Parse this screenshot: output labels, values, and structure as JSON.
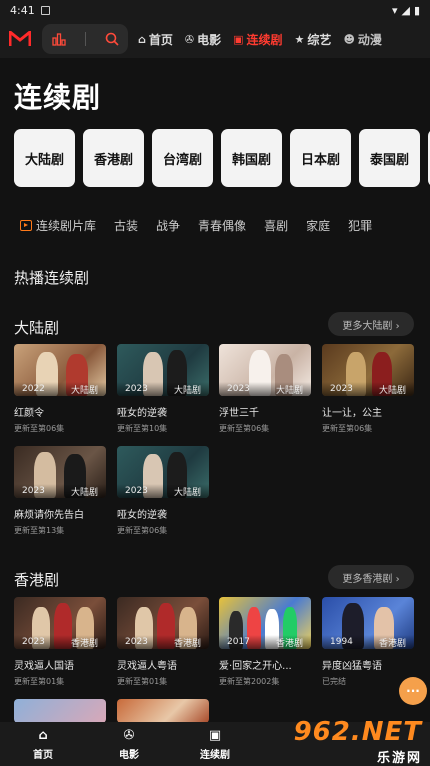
{
  "status": {
    "time": "4:41"
  },
  "topnav": {
    "tabs": [
      {
        "label": "首页",
        "icon": "home-icon"
      },
      {
        "label": "电影",
        "icon": "film-reel-icon"
      },
      {
        "label": "连续剧",
        "icon": "tv-icon"
      },
      {
        "label": "综艺",
        "icon": "star-icon"
      },
      {
        "label": "动漫",
        "icon": "mask-icon"
      }
    ]
  },
  "headline": "连续剧",
  "regions": [
    "大陆剧",
    "香港剧",
    "台湾剧",
    "韩国剧",
    "日本剧",
    "泰国剧"
  ],
  "filters": [
    "连续剧片库",
    "古装",
    "战争",
    "青春偶像",
    "喜剧",
    "家庭",
    "犯罪"
  ],
  "hot_title": "热播连续剧",
  "sections": [
    {
      "title": "大陆剧",
      "more": "更多大陆剧 ›",
      "cards": [
        {
          "year": "2022",
          "region": "大陆剧",
          "title": "红颜令",
          "sub": "更新至第06集"
        },
        {
          "year": "2023",
          "region": "大陆剧",
          "title": "哑女的逆袭",
          "sub": "更新至第10集"
        },
        {
          "year": "2023",
          "region": "大陆剧",
          "title": "浮世三千",
          "sub": "更新至第06集"
        },
        {
          "year": "2023",
          "region": "大陆剧",
          "title": "让一让，公主",
          "sub": "更新至第06集"
        },
        {
          "year": "2023",
          "region": "大陆剧",
          "title": "麻烦请你先告白",
          "sub": "更新至第13集"
        },
        {
          "year": "2023",
          "region": "大陆剧",
          "title": "哑女的逆袭",
          "sub": "更新至第06集"
        }
      ]
    },
    {
      "title": "香港剧",
      "more": "更多香港剧 ›",
      "cards": [
        {
          "year": "2023",
          "region": "香港剧",
          "title": "灵戏逼人国语",
          "sub": "更新至第01集"
        },
        {
          "year": "2023",
          "region": "香港剧",
          "title": "灵戏逼人粤语",
          "sub": "更新至第01集"
        },
        {
          "year": "2017",
          "region": "香港剧",
          "title": "爱·回家之开心...",
          "sub": "更新至第2002集"
        },
        {
          "year": "1994",
          "region": "香港剧",
          "title": "异度凶猛粤语",
          "sub": "已完结"
        }
      ]
    }
  ],
  "bottombar": [
    {
      "label": "首页",
      "icon": "home-icon"
    },
    {
      "label": "电影",
      "icon": "film-reel-icon"
    },
    {
      "label": "连续剧",
      "icon": "tv-icon"
    }
  ],
  "watermark": {
    "main": "962.NET",
    "sub": "乐游网"
  },
  "colors": {
    "accent": "#ff3b30",
    "bg": "#121212",
    "fab": "#f5a04b"
  }
}
